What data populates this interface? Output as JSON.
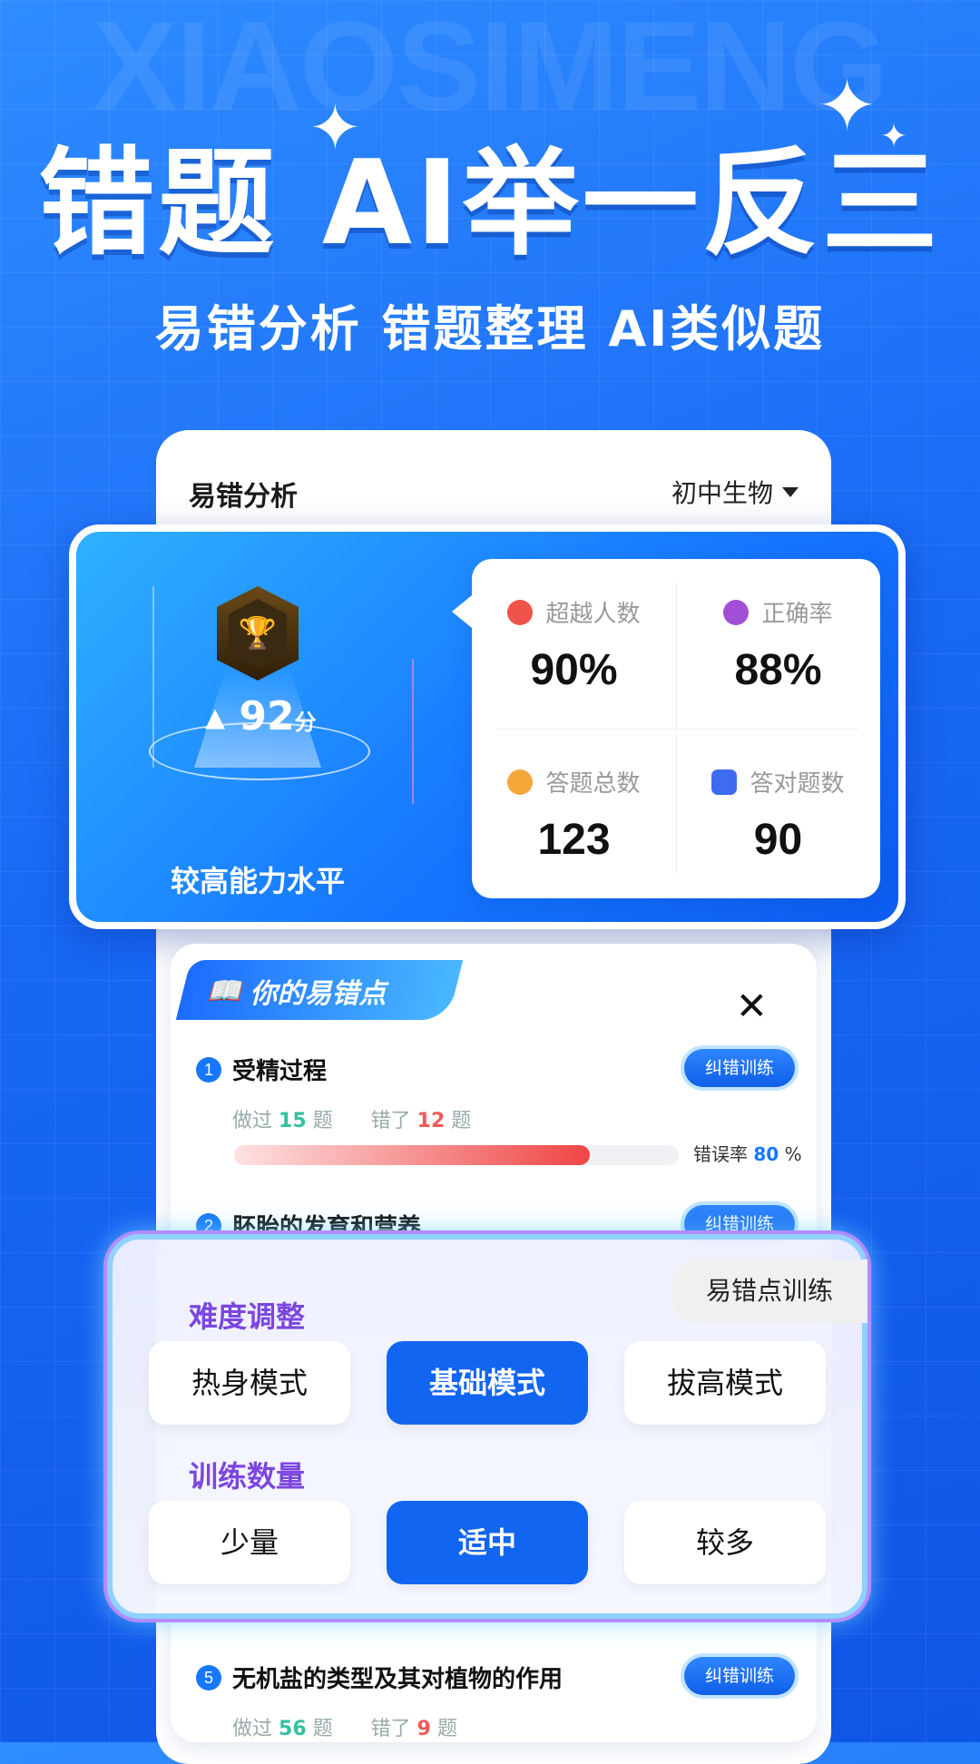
{
  "watermark": "XIAOSIMENG",
  "hero": {
    "title": "错题 AI举一反三",
    "subtitle": "易错分析 错题整理 AI类似题"
  },
  "panel": {
    "title": "易错分析",
    "subject": "初中生物"
  },
  "score": {
    "value": "92",
    "unit": "分",
    "level": "较高能力水平"
  },
  "stats": [
    {
      "label": "超越人数",
      "value": "90%",
      "icon": "rank-icon",
      "color": "#f0534a"
    },
    {
      "label": "正确率",
      "value": "88%",
      "icon": "chart-icon",
      "color": "#a24fd8"
    },
    {
      "label": "答题总数",
      "value": "123",
      "icon": "medal-icon",
      "color": "#f4a83a"
    },
    {
      "label": "答对题数",
      "value": "90",
      "icon": "doc-check-icon",
      "color": "#3d6cf0"
    }
  ],
  "errors": {
    "heading": "你的易错点",
    "train_label": "纠错训练",
    "items": [
      {
        "index": "1",
        "title": "受精过程",
        "done_prefix": "做过",
        "done": "15",
        "done_suffix": "题",
        "wrong_prefix": "错了",
        "wrong": "12",
        "wrong_suffix": "题",
        "rate_label": "错误率",
        "rate": "80",
        "rate_unit": "%",
        "rate_fraction": 0.8
      },
      {
        "index": "2",
        "title": "胚胎的发育和营养"
      },
      {
        "index": "5",
        "title": "无机盐的类型及其对植物的作用",
        "done_prefix": "做过",
        "done": "56",
        "done_suffix": "题",
        "wrong_prefix": "错了",
        "wrong": "9",
        "wrong_suffix": "题"
      }
    ]
  },
  "modal": {
    "tab": "易错点训练",
    "difficulty_heading": "难度调整",
    "difficulty_options": [
      "热身模式",
      "基础模式",
      "拔高模式"
    ],
    "difficulty_selected": "基础模式",
    "quantity_heading": "训练数量",
    "quantity_options": [
      "少量",
      "适中",
      "较多"
    ],
    "quantity_selected": "适中"
  }
}
